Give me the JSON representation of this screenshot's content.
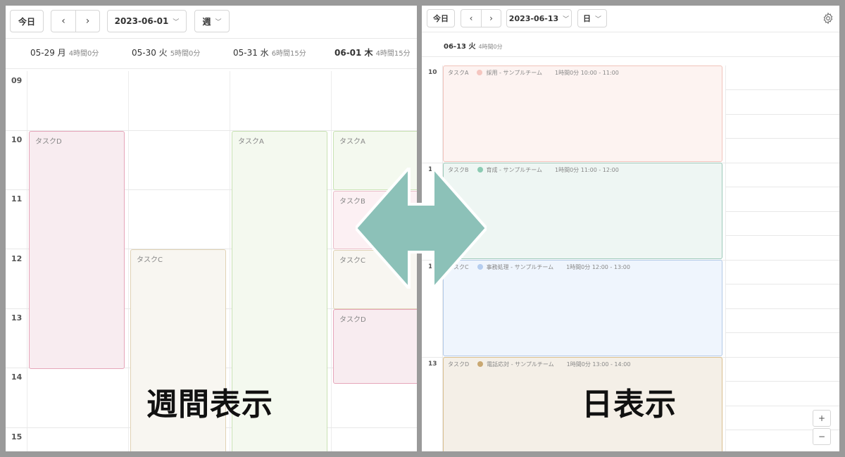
{
  "week": {
    "today_label": "今日",
    "prev_icon": "chevron-left-icon",
    "next_icon": "chevron-right-icon",
    "date": "2023-06-01",
    "view": "週",
    "days": [
      {
        "date": "05-29 月",
        "duration": "4時間0分"
      },
      {
        "date": "05-30 火",
        "duration": "5時間0分"
      },
      {
        "date": "05-31 水",
        "duration": "6時間15分"
      },
      {
        "date": "06-01 木",
        "duration": "4時間15分"
      }
    ],
    "hours": [
      "09",
      "10",
      "11",
      "12",
      "13",
      "14",
      "15"
    ],
    "events": [
      {
        "title": "タスクD"
      },
      {
        "title": "タスクC"
      },
      {
        "title": "タスクA"
      },
      {
        "title": "タスクA"
      },
      {
        "title": "タスクB"
      },
      {
        "title": "タスクC"
      },
      {
        "title": "タスクD"
      }
    ],
    "caption": "週間表示"
  },
  "day": {
    "today_label": "今日",
    "date": "2023-06-13",
    "view": "日",
    "settings_icon": "gear-icon",
    "header": {
      "date": "06-13 火",
      "duration": "4時間0分"
    },
    "hours": [
      "10",
      "1",
      "1",
      "13"
    ],
    "events": [
      {
        "task": "タスクA",
        "category": "採用 - サンプルチーム",
        "duration": "1時間0分",
        "time": "10:00 - 11:00",
        "color": "#f5c6c0"
      },
      {
        "task": "タスクB",
        "category": "育成 - サンプルチーム",
        "duration": "1時間0分",
        "time": "11:00 - 12:00",
        "color": "#8ccbb3"
      },
      {
        "task": "タスクC",
        "category": "事務処理 - サンプルチーム",
        "duration": "1時間0分",
        "time": "12:00 - 13:00",
        "color": "#b5cdef"
      },
      {
        "task": "タスクD",
        "category": "電話応対 - サンプルチーム",
        "duration": "1時間0分",
        "time": "13:00 - 14:00",
        "color": "#c9a872"
      }
    ],
    "zoom_in": "+",
    "zoom_out": "−",
    "caption": "日表示"
  },
  "colors": {
    "arrow": "#8cc1b8"
  }
}
